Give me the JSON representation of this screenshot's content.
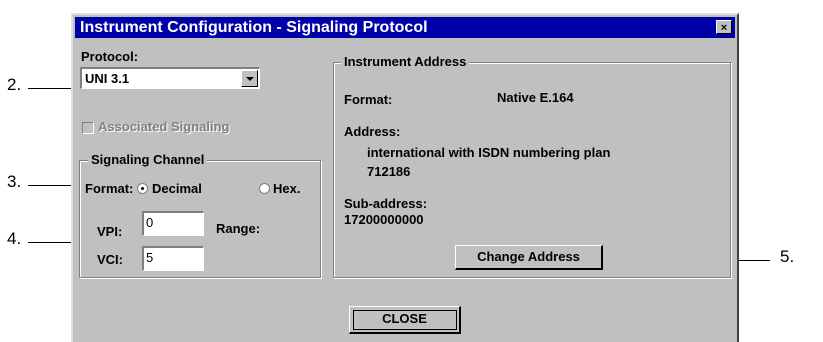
{
  "dialog": {
    "title": "Instrument Configuration - Signaling Protocol",
    "close_glyph": "×"
  },
  "protocol": {
    "label": "Protocol:",
    "value": "UNI 3.1"
  },
  "associated_signaling": {
    "label": "Associated Signaling",
    "checked": false,
    "enabled": false
  },
  "signaling_channel": {
    "title": "Signaling Channel",
    "format_label": "Format:",
    "format_options": [
      "Decimal",
      "Hex."
    ],
    "format_selected": "Decimal",
    "vpi_label": "VPI:",
    "vpi_value": "0",
    "vci_label": "VCI:",
    "vci_value": "5",
    "range_label": "Range:"
  },
  "instrument_address": {
    "title": "Instrument Address",
    "format_label": "Format:",
    "format_value": "Native E.164",
    "address_label": "Address:",
    "address_line1": "international with ISDN numbering plan",
    "address_line2": "712186",
    "subaddress_label": "Sub-address:",
    "subaddress_value": "17200000000",
    "change_button": "Change Address"
  },
  "close_button": "CLOSE",
  "callouts": {
    "c2": "2.",
    "c3": "3.",
    "c4": "4.",
    "c5": "5."
  },
  "colors": {
    "titlebar": "#0000a8",
    "face": "#c0c0c0"
  }
}
